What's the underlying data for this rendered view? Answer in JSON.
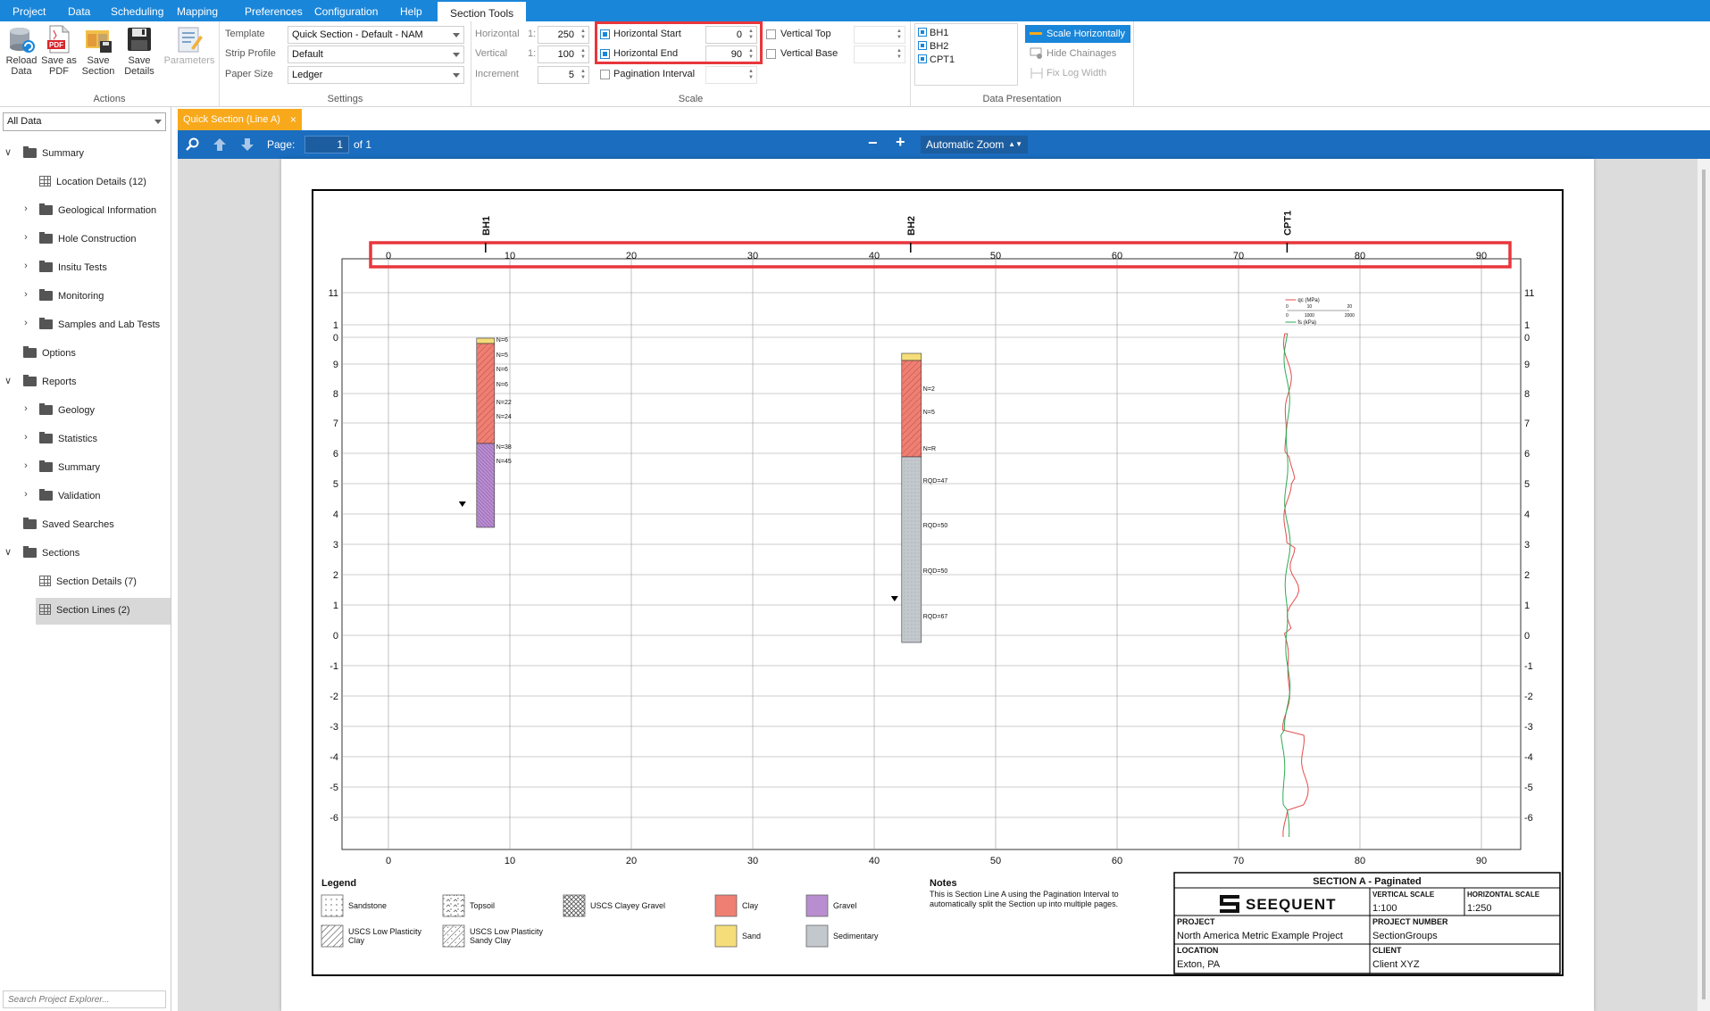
{
  "menu": {
    "items": [
      "Project",
      "Data",
      "Scheduling",
      "Mapping",
      "Preferences",
      "Configuration",
      "Help",
      "Section Tools"
    ],
    "active": "Section Tools"
  },
  "ribbon": {
    "actions": {
      "label": "Actions",
      "buttons": {
        "reload": "Reload Data",
        "save_pdf": "Save as PDF",
        "save_section": "Save Section",
        "save_details": "Save Details",
        "parameters": "Parameters"
      }
    },
    "settings": {
      "label": "Settings",
      "template_label": "Template",
      "template_value": "Quick Section - Default - NAM",
      "strip_label": "Strip Profile",
      "strip_value": "Default",
      "paper_label": "Paper Size",
      "paper_value": "Ledger"
    },
    "scale": {
      "label": "Scale",
      "horizontal_label": "Horizontal",
      "horizontal_value": "250",
      "vertical_label": "Vertical",
      "vertical_value": "100",
      "ratio_prefix": "1:",
      "increment_label": "Increment",
      "increment_value": "5",
      "hstart_label": "Horizontal Start",
      "hstart_value": "0",
      "hend_label": "Horizontal End",
      "hend_value": "90",
      "pagination_label": "Pagination Interval",
      "vtop_label": "Vertical Top",
      "vbase_label": "Vertical Base"
    },
    "presentation": {
      "label": "Data Presentation",
      "holes": [
        "BH1",
        "BH2",
        "CPT1"
      ],
      "scale_horiz": "Scale Horizontally",
      "hide_chainages": "Hide Chainages",
      "fix_log_width": "Fix Log Width"
    }
  },
  "sidebar": {
    "filter": "All Data",
    "search_placeholder": "Search Project Explorer...",
    "items": [
      {
        "label": "Summary",
        "level": 0,
        "icon": "folder",
        "chev": "open"
      },
      {
        "label": "Location Details (12)",
        "level": 1,
        "icon": "grid",
        "chev": ""
      },
      {
        "label": "Geological Information",
        "level": 1,
        "icon": "folder",
        "chev": "closed"
      },
      {
        "label": "Hole Construction",
        "level": 1,
        "icon": "folder",
        "chev": "closed"
      },
      {
        "label": "Insitu Tests",
        "level": 1,
        "icon": "folder",
        "chev": "closed"
      },
      {
        "label": "Monitoring",
        "level": 1,
        "icon": "folder",
        "chev": "closed"
      },
      {
        "label": "Samples and Lab Tests",
        "level": 1,
        "icon": "folder",
        "chev": "closed"
      },
      {
        "label": "Options",
        "level": 0,
        "icon": "folder",
        "chev": ""
      },
      {
        "label": "Reports",
        "level": 0,
        "icon": "folder",
        "chev": "open"
      },
      {
        "label": "Geology",
        "level": 1,
        "icon": "folder",
        "chev": "closed"
      },
      {
        "label": "Statistics",
        "level": 1,
        "icon": "folder",
        "chev": "closed"
      },
      {
        "label": "Summary",
        "level": 1,
        "icon": "folder",
        "chev": "closed"
      },
      {
        "label": "Validation",
        "level": 1,
        "icon": "folder",
        "chev": "closed"
      },
      {
        "label": "Saved Searches",
        "level": 0,
        "icon": "folder",
        "chev": ""
      },
      {
        "label": "Sections",
        "level": 0,
        "icon": "folder",
        "chev": "open"
      },
      {
        "label": "Section Details (7)",
        "level": 1,
        "icon": "grid",
        "chev": ""
      },
      {
        "label": "Section Lines (2)",
        "level": 1,
        "icon": "grid",
        "chev": "",
        "selected": true
      }
    ]
  },
  "tab": {
    "label": "Quick Section (Line A)"
  },
  "pdfbar": {
    "page_label": "Page:",
    "page_value": "1",
    "of_label": "of 1",
    "zoom": "Automatic Zoom"
  },
  "section": {
    "x_ticks": [
      "0",
      "10",
      "20",
      "30",
      "40",
      "50",
      "60",
      "70",
      "80",
      "90"
    ],
    "y_ticks": [
      "11",
      "1",
      "0",
      "9",
      "8",
      "7",
      "6",
      "5",
      "4",
      "3",
      "2",
      "1",
      "0",
      "-1",
      "-2",
      "-3",
      "-4",
      "-5",
      "-6"
    ],
    "holes": [
      {
        "name": "BH1",
        "chainage": 8,
        "labels": [
          "N=6",
          "N=5",
          "N=6",
          "N=6",
          "N=22",
          "N=24",
          "N=38",
          "N=45"
        ]
      },
      {
        "name": "BH2",
        "chainage": 43,
        "labels": [
          "N=2",
          "N=5",
          "N=R",
          "RQD=47",
          "RQD=50",
          "RQD=50",
          "RQD=67"
        ]
      },
      {
        "name": "CPT1",
        "chainage": 74,
        "cpt_qc": "qc (MPa)",
        "cpt_fs": "fs (kPa)",
        "cpt_axis": [
          "0",
          "10",
          "20",
          "0",
          "1000",
          "2000"
        ]
      }
    ],
    "legend": {
      "title": "Legend",
      "items": [
        {
          "label": "Sandstone",
          "pattern": "dots",
          "color": "#ffffff"
        },
        {
          "label": "Topsoil",
          "pattern": "topsoil",
          "color": "#ffffff"
        },
        {
          "label": "USCS Clayey Gravel",
          "pattern": "cross",
          "color": "#ffffff"
        },
        {
          "label": "Clay",
          "pattern": "solid",
          "color": "#ef7f73"
        },
        {
          "label": "Gravel",
          "pattern": "solid",
          "color": "#b98ed0"
        },
        {
          "label": "USCS Low Plasticity Clay",
          "pattern": "hatch",
          "color": "#ffffff"
        },
        {
          "label": "USCS Low Plasticity Sandy Clay",
          "pattern": "hatchdots",
          "color": "#ffffff"
        },
        {
          "label": "Sand",
          "pattern": "solid",
          "color": "#f5dd7a"
        },
        {
          "label": "Sedimentary",
          "pattern": "solid",
          "color": "#c3c8cc"
        }
      ]
    },
    "notes": {
      "title": "Notes",
      "text": "This is Section Line A using the Pagination Interval to automatically split the Section up into multiple pages."
    },
    "titleblock": {
      "title": "SECTION A - Paginated",
      "logo": "SEEQUENT",
      "vscale_label": "VERTICAL SCALE",
      "vscale_value": "1:100",
      "hscale_label": "HORIZONTAL SCALE",
      "hscale_value": "1:250",
      "project_label": "PROJECT",
      "project_value": "North America Metric Example Project",
      "pnum_label": "PROJECT NUMBER",
      "pnum_value": "SectionGroups",
      "location_label": "LOCATION",
      "location_value": "Exton, PA",
      "client_label": "CLIENT",
      "client_value": "Client XYZ"
    }
  }
}
